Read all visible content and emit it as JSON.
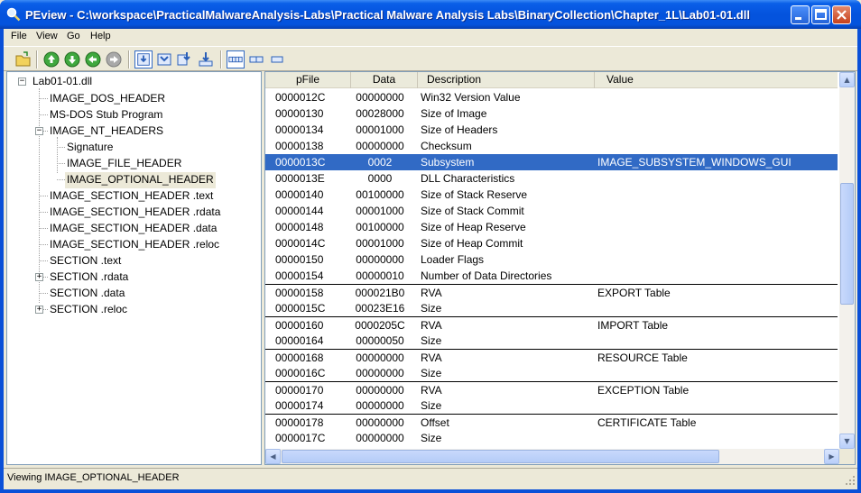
{
  "window": {
    "title": "PEview - C:\\workspace\\PracticalMalwareAnalysis-Labs\\Practical Malware Analysis Labs\\BinaryCollection\\Chapter_1L\\Lab01-01.dll"
  },
  "menu": [
    "File",
    "View",
    "Go",
    "Help"
  ],
  "toolbar": {
    "icons": [
      "open-icon",
      "up-icon",
      "down-icon",
      "back-icon",
      "forward-icon",
      "view-byte-icon",
      "view-word-icon",
      "view-dword-icon",
      "view-qword-icon",
      "view-hex-icon",
      "view-wide-icon",
      "view-narrow-icon"
    ]
  },
  "tree": {
    "root": "Lab01-01.dll",
    "items": [
      {
        "label": "IMAGE_DOS_HEADER",
        "level": 1
      },
      {
        "label": "MS-DOS Stub Program",
        "level": 1
      },
      {
        "label": "IMAGE_NT_HEADERS",
        "level": 1,
        "expanded": true
      },
      {
        "label": "Signature",
        "level": 2
      },
      {
        "label": "IMAGE_FILE_HEADER",
        "level": 2
      },
      {
        "label": "IMAGE_OPTIONAL_HEADER",
        "level": 2,
        "selected": true
      },
      {
        "label": "IMAGE_SECTION_HEADER .text",
        "level": 1
      },
      {
        "label": "IMAGE_SECTION_HEADER .rdata",
        "level": 1
      },
      {
        "label": "IMAGE_SECTION_HEADER .data",
        "level": 1
      },
      {
        "label": "IMAGE_SECTION_HEADER .reloc",
        "level": 1
      },
      {
        "label": "SECTION .text",
        "level": 1
      },
      {
        "label": "SECTION .rdata",
        "level": 1,
        "collapsed": true
      },
      {
        "label": "SECTION .data",
        "level": 1
      },
      {
        "label": "SECTION .reloc",
        "level": 1,
        "collapsed": true
      }
    ]
  },
  "table": {
    "headers": [
      "pFile",
      "Data",
      "Description",
      "Value"
    ],
    "rows": [
      {
        "pfile": "0000012C",
        "data": "00000000",
        "desc": "Win32 Version Value",
        "value": ""
      },
      {
        "pfile": "00000130",
        "data": "00028000",
        "desc": "Size of Image",
        "value": ""
      },
      {
        "pfile": "00000134",
        "data": "00001000",
        "desc": "Size of Headers",
        "value": ""
      },
      {
        "pfile": "00000138",
        "data": "00000000",
        "desc": "Checksum",
        "value": ""
      },
      {
        "pfile": "0000013C",
        "data": "0002",
        "desc": "Subsystem",
        "value": "IMAGE_SUBSYSTEM_WINDOWS_GUI",
        "selected": true
      },
      {
        "pfile": "0000013E",
        "data": "0000",
        "desc": "DLL Characteristics",
        "value": ""
      },
      {
        "pfile": "00000140",
        "data": "00100000",
        "desc": "Size of Stack Reserve",
        "value": ""
      },
      {
        "pfile": "00000144",
        "data": "00001000",
        "desc": "Size of Stack Commit",
        "value": ""
      },
      {
        "pfile": "00000148",
        "data": "00100000",
        "desc": "Size of Heap Reserve",
        "value": ""
      },
      {
        "pfile": "0000014C",
        "data": "00001000",
        "desc": "Size of Heap Commit",
        "value": ""
      },
      {
        "pfile": "00000150",
        "data": "00000000",
        "desc": "Loader Flags",
        "value": ""
      },
      {
        "pfile": "00000154",
        "data": "00000010",
        "desc": "Number of Data Directories",
        "value": ""
      },
      {
        "pfile": "00000158",
        "data": "000021B0",
        "desc": "RVA",
        "value": "EXPORT Table",
        "group": true
      },
      {
        "pfile": "0000015C",
        "data": "00023E16",
        "desc": "Size",
        "value": ""
      },
      {
        "pfile": "00000160",
        "data": "0000205C",
        "desc": "RVA",
        "value": "IMPORT Table",
        "group": true
      },
      {
        "pfile": "00000164",
        "data": "00000050",
        "desc": "Size",
        "value": ""
      },
      {
        "pfile": "00000168",
        "data": "00000000",
        "desc": "RVA",
        "value": "RESOURCE Table",
        "group": true
      },
      {
        "pfile": "0000016C",
        "data": "00000000",
        "desc": "Size",
        "value": ""
      },
      {
        "pfile": "00000170",
        "data": "00000000",
        "desc": "RVA",
        "value": "EXCEPTION Table",
        "group": true
      },
      {
        "pfile": "00000174",
        "data": "00000000",
        "desc": "Size",
        "value": ""
      },
      {
        "pfile": "00000178",
        "data": "00000000",
        "desc": "Offset",
        "value": "CERTIFICATE Table",
        "group": true
      },
      {
        "pfile": "0000017C",
        "data": "00000000",
        "desc": "Size",
        "value": ""
      }
    ]
  },
  "status": {
    "text": "Viewing IMAGE_OPTIONAL_HEADER"
  },
  "colors": {
    "selection": "#316ac5",
    "titlebar": "#0453dd"
  }
}
